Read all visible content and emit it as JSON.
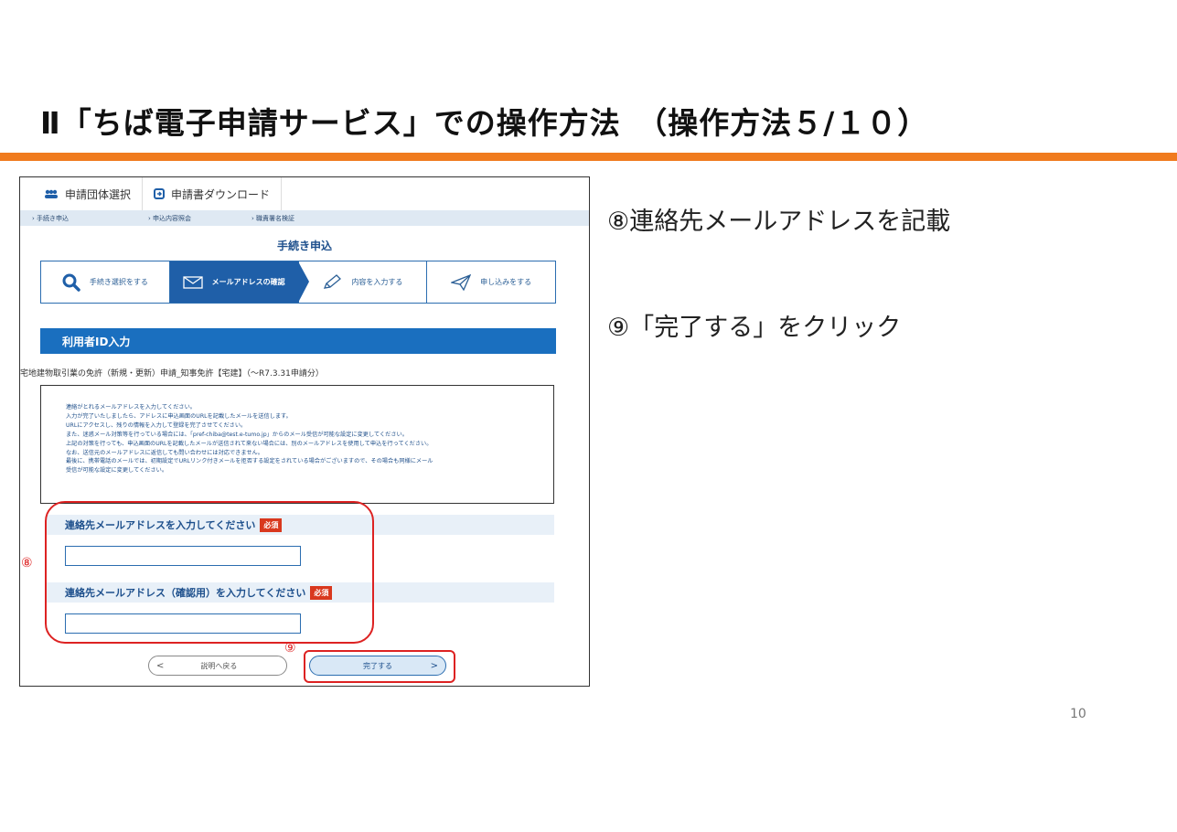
{
  "slide": {
    "title": "Ⅱ「ちば電子申請サービス」での操作方法　（操作方法５/１０）",
    "page_number": "10",
    "notes": [
      "⑧連絡先メールアドレスを記載",
      "⑨「完了する」をクリック"
    ]
  },
  "screenshot": {
    "top_tabs": [
      {
        "icon": "group-icon",
        "label": "申請団体選択"
      },
      {
        "icon": "download-icon",
        "label": "申請書ダウンロード"
      }
    ],
    "subnav": [
      "手続き申込",
      "申込内容照会",
      "職責署名検証"
    ],
    "panel_title": "手続き申込",
    "steps": [
      {
        "icon": "search-icon",
        "label": "手続き選択をする"
      },
      {
        "icon": "envelope-icon",
        "label": "メールアドレスの確認",
        "active": true
      },
      {
        "icon": "pencil-icon",
        "label": "内容を入力する"
      },
      {
        "icon": "paper-plane-icon",
        "label": "申し込みをする"
      }
    ],
    "section_title": "利用者ID入力",
    "application_name": "宅地建物取引業の免許（新規・更新）申請_知事免許【宅建】（～R7.3.31申請分）",
    "instructions": [
      "連絡がとれるメールアドレスを入力してください。",
      "入力が完了いたしましたら、アドレスに申込画面のURLを記載したメールを送信します。",
      "URLにアクセスし、残りの情報を入力して登録を完了させてください。",
      "また、迷惑メール対策等を行っている場合には、「pref-chiba@test.e-tumo.jp」からのメール受信が可能な設定に変更してください。",
      "上記の対策を行っても、申込画面のURLを記載したメールが送信されて来ない場合には、別のメールアドレスを使用して申込を行ってください。",
      "なお、送信元のメールアドレスに返信しても問い合わせには対応できません。",
      "最後に、携帯電話のメールでは、初期設定でURLリンク付きメールを拒否する設定をされている場合がございますので、その場合も同様にメール",
      "受信が可能な設定に変更してください。"
    ],
    "field_email_label": "連絡先メールアドレスを入力してください",
    "field_email_value": "",
    "field_confirm_label": "連絡先メールアドレス（確認用）を入力してください",
    "field_confirm_value": "",
    "required_badge": "必須",
    "marker_8": "⑧",
    "marker_9": "⑨",
    "back_button": {
      "arrow": "<",
      "label": "説明へ戻る"
    },
    "done_button": {
      "label": "完了する",
      "arrow": ">"
    }
  },
  "colors": {
    "accent_orange": "#f07b1e",
    "primary_blue": "#1f5fa8",
    "required_red": "#d9381e",
    "annotation_red": "#dd2222"
  }
}
